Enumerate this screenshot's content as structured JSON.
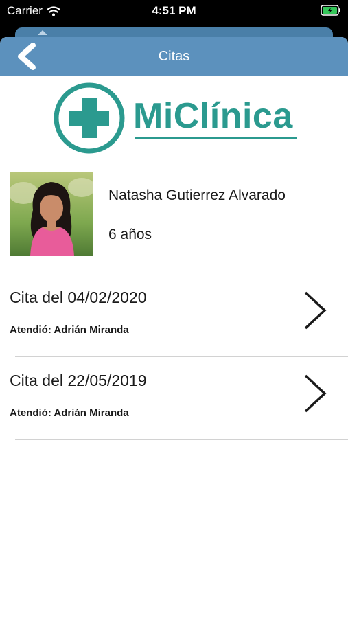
{
  "status_bar": {
    "carrier": "Carrier",
    "time": "4:51 PM"
  },
  "navbar": {
    "title": "Citas"
  },
  "logo": {
    "text": "MiClínica"
  },
  "patient": {
    "name": "Natasha Gutierrez Alvarado",
    "age": "6 años"
  },
  "appointments": [
    {
      "title": "Cita del 04/02/2020",
      "doctor": "Atendió: Adrián Miranda"
    },
    {
      "title": "Cita del 22/05/2019",
      "doctor": "Atendió: Adrián Miranda"
    }
  ],
  "colors": {
    "navbar": "#5c91bd",
    "brand": "#2b9a8f",
    "battery": "#34c759"
  }
}
